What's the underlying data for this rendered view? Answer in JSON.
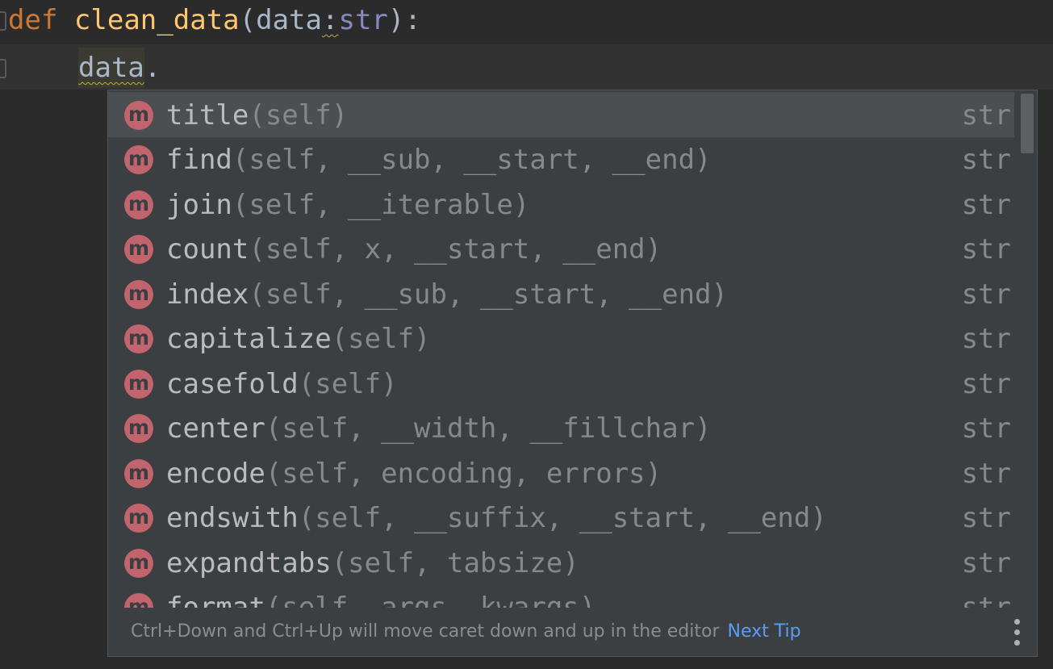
{
  "editor": {
    "line1": {
      "keyword": "def",
      "function_name": "clean_data",
      "open_paren": "(",
      "param": "data",
      "colon": ":",
      "type": "str",
      "close": "):"
    },
    "line2": {
      "identifier": "data",
      "dot": "."
    }
  },
  "completion": {
    "icon_letter": "m",
    "items": [
      {
        "name": "title",
        "signature": "(self)",
        "type": "str"
      },
      {
        "name": "find",
        "signature": "(self, __sub, __start, __end)",
        "type": "str"
      },
      {
        "name": "join",
        "signature": "(self, __iterable)",
        "type": "str"
      },
      {
        "name": "count",
        "signature": "(self, x, __start, __end)",
        "type": "str"
      },
      {
        "name": "index",
        "signature": "(self, __sub, __start, __end)",
        "type": "str"
      },
      {
        "name": "capitalize",
        "signature": "(self)",
        "type": "str"
      },
      {
        "name": "casefold",
        "signature": "(self)",
        "type": "str"
      },
      {
        "name": "center",
        "signature": "(self, __width, __fillchar)",
        "type": "str"
      },
      {
        "name": "encode",
        "signature": "(self, encoding, errors)",
        "type": "str"
      },
      {
        "name": "endswith",
        "signature": "(self, __suffix, __start, __end)",
        "type": "str"
      },
      {
        "name": "expandtabs",
        "signature": "(self, tabsize)",
        "type": "str"
      },
      {
        "name": "format",
        "signature": "(self, args, kwargs)",
        "type": "str"
      }
    ],
    "footer": {
      "tip": "Ctrl+Down and Ctrl+Up will move caret down and up in the editor",
      "next_tip": "Next Tip"
    }
  },
  "colors": {
    "background": "#2b2b2b",
    "popup": "#3c3f41",
    "selected_row": "#4b4f52",
    "method_icon": "#c2646d",
    "keyword": "#cc7832",
    "function": "#ffc66d",
    "link": "#589df6"
  },
  "icons": {
    "method": "method-icon",
    "more": "vertical-ellipsis-icon"
  }
}
